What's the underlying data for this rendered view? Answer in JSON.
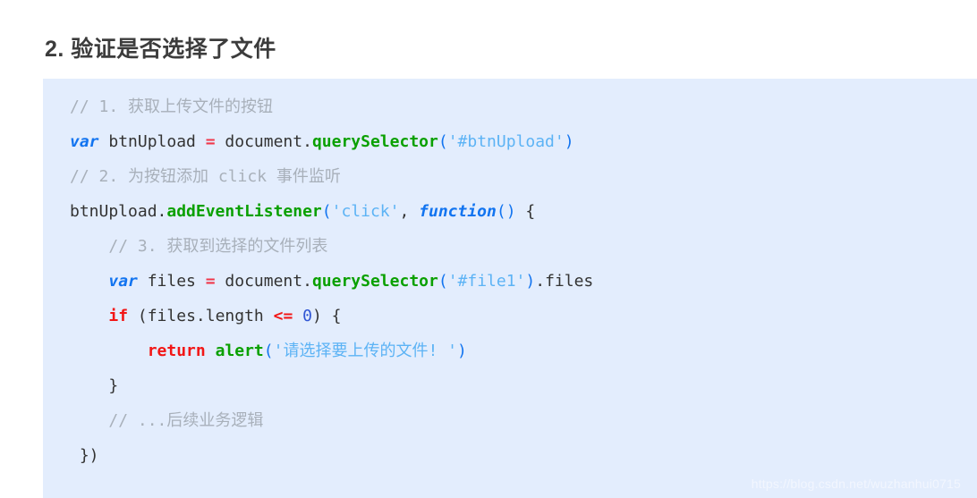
{
  "heading": "2. 验证是否选择了文件",
  "colors": {
    "page_background": "#ffffff",
    "code_background": "#e3edfd",
    "heading_text": "#3c3c3c",
    "comment": "#a8b0ba",
    "keyword": "#1274f0",
    "control": "#f21616",
    "operator": "#f0374a",
    "function": "#0aa000",
    "string": "#5cb3f5",
    "punctuation": "#1274f0",
    "number": "#2f55d4",
    "plain": "#333333",
    "watermark": "#f2f6fe"
  },
  "code": {
    "language": "javascript",
    "lines": [
      {
        "indent": 0,
        "tokens": [
          {
            "t": "// 1. 获取上传文件的按钮",
            "c": "comment"
          }
        ]
      },
      {
        "indent": 0,
        "tokens": [
          {
            "t": "var",
            "c": "keyword"
          },
          {
            "t": " btnUpload ",
            "c": "plain"
          },
          {
            "t": "=",
            "c": "operator"
          },
          {
            "t": " document.",
            "c": "plain"
          },
          {
            "t": "querySelector",
            "c": "func"
          },
          {
            "t": "(",
            "c": "punct"
          },
          {
            "t": "'#btnUpload'",
            "c": "string"
          },
          {
            "t": ")",
            "c": "punct"
          }
        ]
      },
      {
        "indent": 0,
        "tokens": [
          {
            "t": "// 2. 为按钮添加 click 事件监听",
            "c": "comment"
          }
        ]
      },
      {
        "indent": 0,
        "tokens": [
          {
            "t": "btnUpload.",
            "c": "plain"
          },
          {
            "t": "addEventListener",
            "c": "func"
          },
          {
            "t": "(",
            "c": "punct"
          },
          {
            "t": "'click'",
            "c": "string"
          },
          {
            "t": ", ",
            "c": "plain"
          },
          {
            "t": "function",
            "c": "keyword"
          },
          {
            "t": "(",
            "c": "punct"
          },
          {
            "t": ")",
            "c": "punct"
          },
          {
            "t": " {",
            "c": "plain"
          }
        ]
      },
      {
        "indent": 4,
        "tokens": [
          {
            "t": "// 3. 获取到选择的文件列表",
            "c": "comment"
          }
        ]
      },
      {
        "indent": 4,
        "tokens": [
          {
            "t": "var",
            "c": "keyword"
          },
          {
            "t": " files ",
            "c": "plain"
          },
          {
            "t": "=",
            "c": "operator"
          },
          {
            "t": " document.",
            "c": "plain"
          },
          {
            "t": "querySelector",
            "c": "func"
          },
          {
            "t": "(",
            "c": "punct"
          },
          {
            "t": "'#file1'",
            "c": "string"
          },
          {
            "t": ")",
            "c": "punct"
          },
          {
            "t": ".files",
            "c": "plain"
          }
        ]
      },
      {
        "indent": 4,
        "tokens": [
          {
            "t": "if",
            "c": "control"
          },
          {
            "t": " (files.length ",
            "c": "plain"
          },
          {
            "t": "<=",
            "c": "control"
          },
          {
            "t": " ",
            "c": "plain"
          },
          {
            "t": "0",
            "c": "number"
          },
          {
            "t": ") {",
            "c": "plain"
          }
        ]
      },
      {
        "indent": 8,
        "tokens": [
          {
            "t": "return",
            "c": "control"
          },
          {
            "t": " ",
            "c": "plain"
          },
          {
            "t": "alert",
            "c": "func"
          },
          {
            "t": "(",
            "c": "punct"
          },
          {
            "t": "'请选择要上传的文件! '",
            "c": "string"
          },
          {
            "t": ")",
            "c": "punct"
          }
        ]
      },
      {
        "indent": 4,
        "tokens": [
          {
            "t": "}",
            "c": "plain"
          }
        ]
      },
      {
        "indent": 4,
        "tokens": [
          {
            "t": "// ...后续业务逻辑",
            "c": "comment"
          }
        ]
      },
      {
        "indent": 1,
        "tokens": [
          {
            "t": "})",
            "c": "plain"
          }
        ]
      }
    ]
  },
  "watermark": "https://blog.csdn.net/wuzhanhui0715"
}
